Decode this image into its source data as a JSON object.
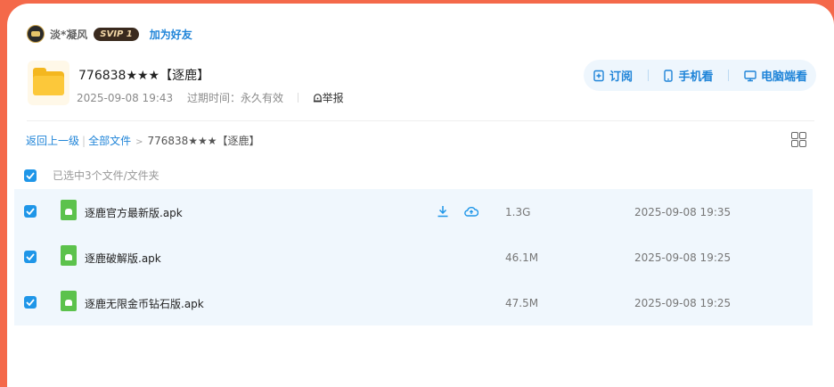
{
  "user": {
    "name": "淡*凝风",
    "vip_badge": "SVIP 1",
    "add_friend": "加为好友"
  },
  "share": {
    "title": "776838★★★【逐鹿】",
    "date": "2025-09-08 19:43",
    "expire": "过期时间：永久有效",
    "report": "举报"
  },
  "actions": {
    "subscribe": "订阅",
    "mobile": "手机看",
    "pc": "电脑端看"
  },
  "breadcrumb": {
    "back": "返回上一级",
    "all_files": "全部文件",
    "current": "776838★★★【逐鹿】"
  },
  "selection": {
    "text": "已选中3个文件/文件夹"
  },
  "colors": {
    "accent": "#1f84d8",
    "background": "#f4694a",
    "row_bg": "#f0f7fd",
    "apk_icon": "#5cc24c"
  },
  "files": [
    {
      "name": "逐鹿官方最新版.apk",
      "size": "1.3G",
      "time": "2025-09-08 19:35",
      "icon": "android-file-icon"
    },
    {
      "name": "逐鹿破解版.apk",
      "size": "46.1M",
      "time": "2025-09-08 19:25",
      "icon": "android-file-icon"
    },
    {
      "name": "逐鹿无限金币钻石版.apk",
      "size": "47.5M",
      "time": "2025-09-08 19:25",
      "icon": "android-file-icon"
    }
  ]
}
